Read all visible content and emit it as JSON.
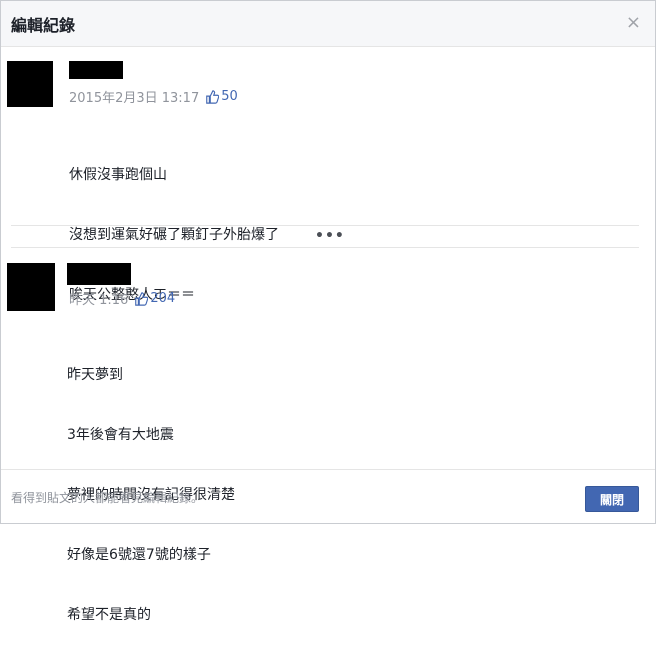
{
  "dialog": {
    "title": "編輯紀錄",
    "close_icon": "×"
  },
  "entries": [
    {
      "timestamp": "2015年2月3日 13:17",
      "likes": "50",
      "lines": [
        "休假沒事跑個山",
        "沒想到運氣好碾了顆釘子外胎爆了",
        "唉天公整憨人ㄛ＝＝"
      ]
    },
    {
      "timestamp": "昨天 1:16",
      "likes": "204",
      "lines": [
        "昨天夢到",
        "3年後會有大地震",
        "夢裡的時間沒有記得很清楚",
        "好像是6號還7號的樣子",
        "希望不是真的"
      ]
    }
  ],
  "more_label": "•••",
  "footer": {
    "note": "看得到貼文的人都能看見編輯紀錄。",
    "close_button": "關閉"
  },
  "colors": {
    "accent": "#4267b2",
    "like_blue": "#4267b2",
    "meta_gray": "#90949c"
  },
  "icons": [
    "close-icon",
    "thumbs-up-icon",
    "more-dots-icon"
  ]
}
